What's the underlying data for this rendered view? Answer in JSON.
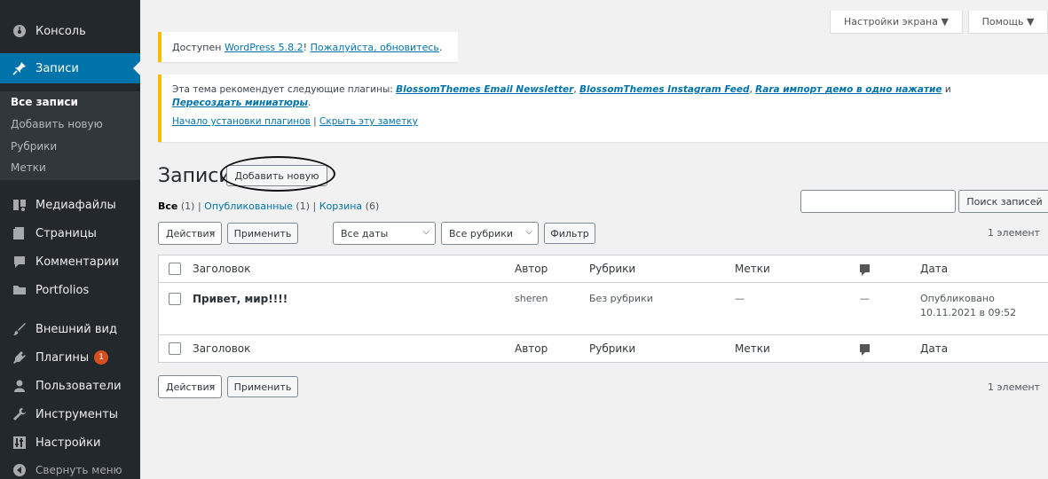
{
  "sidebar": {
    "console": "Консоль",
    "posts": "Записи",
    "sub_all": "Все записи",
    "sub_add": "Добавить новую",
    "sub_categories": "Рубрики",
    "sub_tags": "Метки",
    "media": "Медиафайлы",
    "pages": "Страницы",
    "comments": "Комментарии",
    "portfolios": "Portfolios",
    "appearance": "Внешний вид",
    "plugins": "Плагины",
    "plugins_badge": "1",
    "users": "Пользователи",
    "tools": "Инструменты",
    "settings": "Настройки",
    "collapse": "Свернуть меню"
  },
  "top_tabs": {
    "screen_options": "Настройки экрана ▼",
    "help": "Помощь ▼"
  },
  "update_notice": {
    "prefix": "Доступен ",
    "wp_link": "WordPress 5.8.2",
    "mid": "! ",
    "update_link": "Пожалуйста, обновитесь",
    "suffix": "."
  },
  "plugin_notice": {
    "prefix": "Эта тема рекомендует следующие плагины: ",
    "plugin1": "BlossomThemes Email Newsletter",
    "sep1": ", ",
    "plugin2": "BlossomThemes Instagram Feed",
    "sep2": ", ",
    "plugin3": "Rara импорт демо в одно нажатие",
    "and": " и",
    "plugin4": "Пересоздать миниатюры",
    "dot": ".",
    "install_link": "Начало установки плагинов",
    "divider": " | ",
    "hide_link": "Скрыть эту заметку"
  },
  "page": {
    "title": "Записи",
    "add_new": "Добавить новую"
  },
  "filters": {
    "all_label": "Все",
    "all_count": " (1)",
    "sep": " | ",
    "published_label": "Опубликованные",
    "published_count": " (1)",
    "trash_label": "Корзина",
    "trash_count": " (6)"
  },
  "search": {
    "button": "Поиск записей",
    "placeholder": ""
  },
  "tablenav_top": {
    "bulk_actions": "Действия",
    "apply": "Применить",
    "all_dates": "Все даты",
    "all_categories": "Все рубрики",
    "filter": "Фильтр",
    "count": "1 элемент"
  },
  "table": {
    "headers": {
      "title": "Заголовок",
      "author": "Автор",
      "categories": "Рубрики",
      "tags": "Метки",
      "date": "Дата"
    },
    "rows": [
      {
        "title": "Привет, мир!!!!",
        "author": "sheren",
        "categories": "Без рубрики",
        "tags": "—",
        "comments": "—",
        "date_status": "Опубликовано",
        "date": "10.11.2021 в 09:52"
      }
    ]
  },
  "tablenav_bottom": {
    "bulk_actions": "Действия",
    "apply": "Применить",
    "count": "1 элемент"
  },
  "colors": {
    "sidebar_bg": "#23282d",
    "active_menu": "#0073aa",
    "link": "#0073aa",
    "notice_border": "#ffb900"
  }
}
